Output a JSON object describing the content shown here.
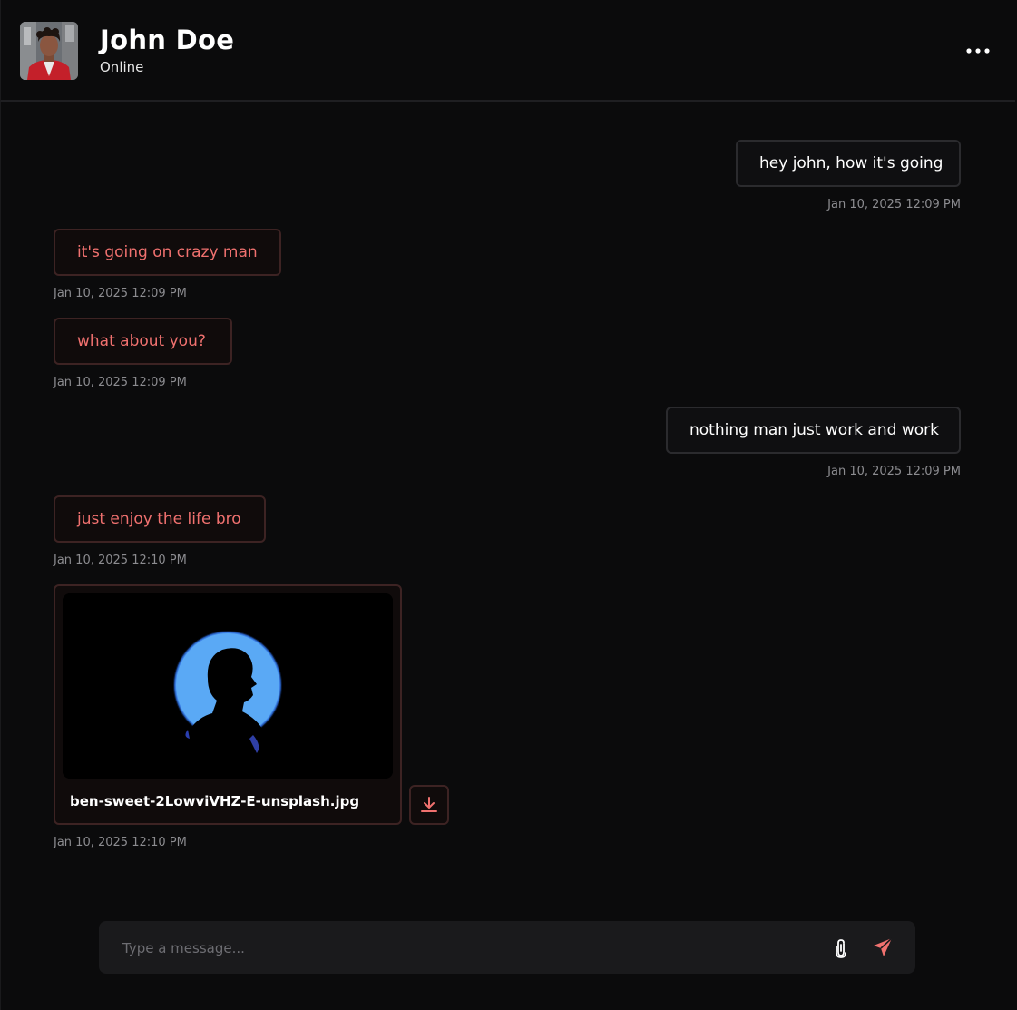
{
  "header": {
    "name": "John Doe",
    "status": "Online"
  },
  "messages": [
    {
      "direction": "sent",
      "text": "hey john, how it's going",
      "time": "Jan 10, 2025 12:09 PM"
    },
    {
      "direction": "received",
      "text": "it's going on crazy man",
      "time": "Jan 10, 2025 12:09 PM"
    },
    {
      "direction": "received",
      "text": "what about you?",
      "time": "Jan 10, 2025 12:09 PM"
    },
    {
      "direction": "sent",
      "text": "nothing man just work and work",
      "time": "Jan 10, 2025 12:09 PM"
    },
    {
      "direction": "received",
      "text": "just enjoy the life bro",
      "time": "Jan 10, 2025 12:10 PM"
    }
  ],
  "attachment": {
    "filename": "ben-sweet-2LowviVHZ-E-unsplash.jpg",
    "time": "Jan 10, 2025 12:10 PM",
    "icon": "download-icon"
  },
  "composer": {
    "placeholder": "Type a message...",
    "value": "",
    "attach_icon": "paperclip-icon",
    "send_icon": "send-icon"
  },
  "colors": {
    "background": "#0b0b0c",
    "accent": "#f0716f",
    "sent_border": "#2b2b2e",
    "received_border": "#3d2323",
    "composer_bg": "#1a1a1c",
    "photo_blue": "#5aa9f5"
  }
}
